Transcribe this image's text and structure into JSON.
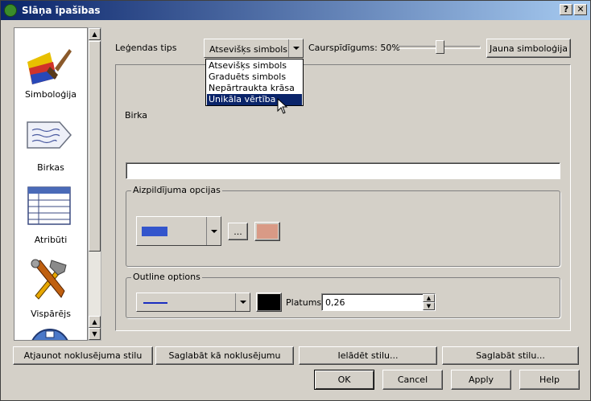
{
  "window": {
    "title": "Slāņa īpašības",
    "help_btn": "?",
    "close_btn": "✕"
  },
  "sidebar": {
    "items": [
      {
        "label": "Simboloģija",
        "icon": "paintbrush-icon"
      },
      {
        "label": "Birkas",
        "icon": "label-tag-icon"
      },
      {
        "label": "Atribūti",
        "icon": "table-icon"
      },
      {
        "label": "Vispārējs",
        "icon": "tools-icon"
      }
    ]
  },
  "symbology": {
    "legend_type_label": "Leģendas tips",
    "legend_type_value": "Atsevišķs simbols",
    "transparency_label": "Caurspīdīgums: 50%",
    "transparency_value": 0.5,
    "new_symbology_button": "Jauna simboloģija",
    "dropdown_options": [
      "Atsevišķs simbols",
      "Graduēts simbols",
      "Nepārtraukta krāsa",
      "Unikāla vērtība"
    ],
    "dropdown_selected": "Unikāla vērtība",
    "label_label": "Birka",
    "label_value": "",
    "fill_options_title": "Aizpildījuma opcijas",
    "fill_browse_button": "...",
    "fill_color": "#3355cc",
    "fill_color_swatch": "#d99a86",
    "outline_options_title": "Outline options",
    "outline_color": "#000000",
    "line_color": "#1a2ec0",
    "width_label": "Platums",
    "width_value": "0,26"
  },
  "style_buttons": {
    "restore_default": "Atjaunot noklusējuma stilu",
    "save_default": "Saglabāt kā noklusējumu",
    "load_style": "Ielādēt stilu...",
    "save_style": "Saglabāt stilu..."
  },
  "dialog_buttons": {
    "ok": "OK",
    "cancel": "Cancel",
    "apply": "Apply",
    "help": "Help"
  }
}
